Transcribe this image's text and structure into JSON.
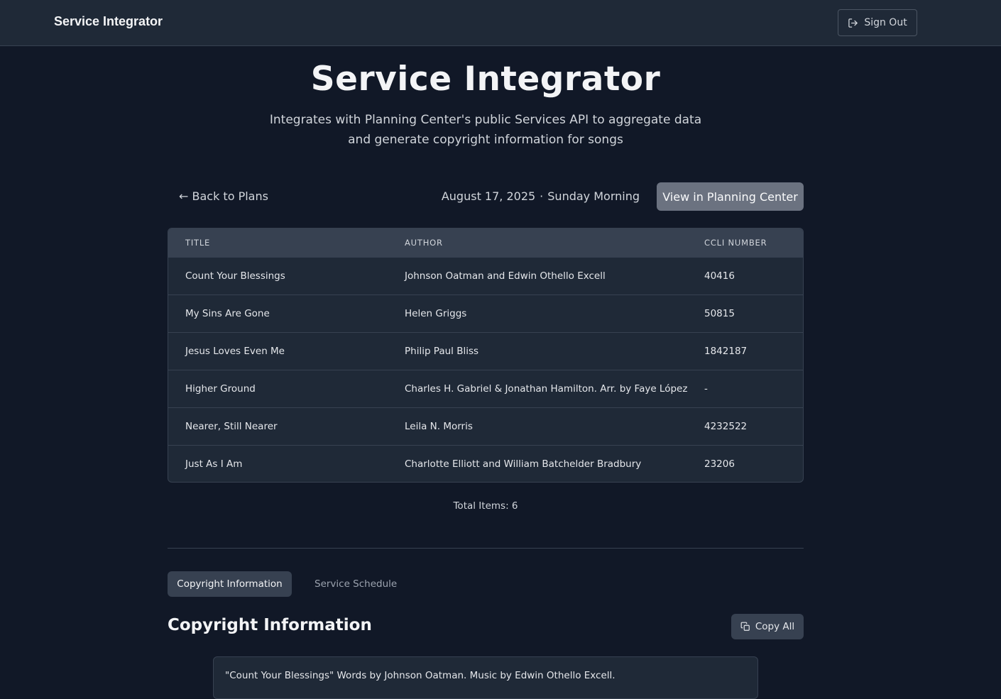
{
  "header": {
    "brand": "Service Integrator",
    "sign_out_label": "Sign Out",
    "sign_out_icon": "sign-out-icon"
  },
  "hero": {
    "title": "Service Integrator",
    "subtitle": "Integrates with Planning Center's public Services API to aggregate data and generate copyright information for songs"
  },
  "plan": {
    "back_label": "← Back to Plans",
    "date": "August 17, 2025",
    "separator": "·",
    "service_type": "Sunday Morning",
    "view_button_label": "View in Planning Center"
  },
  "table": {
    "columns": [
      "TITLE",
      "AUTHOR",
      "CCLI NUMBER"
    ],
    "rows": [
      {
        "title": "Count Your Blessings",
        "author": "Johnson Oatman and Edwin Othello Excell",
        "ccli": "40416"
      },
      {
        "title": "My Sins Are Gone",
        "author": "Helen Griggs",
        "ccli": "50815"
      },
      {
        "title": "Jesus Loves Even Me",
        "author": "Philip Paul Bliss",
        "ccli": "1842187"
      },
      {
        "title": "Higher Ground",
        "author": "Charles H. Gabriel & Jonathan Hamilton. Arr. by Faye López",
        "ccli": "-"
      },
      {
        "title": "Nearer, Still Nearer",
        "author": "Leila N. Morris",
        "ccli": "4232522"
      },
      {
        "title": "Just As I Am",
        "author": "Charlotte Elliott and William Batchelder Bradbury",
        "ccli": "23206"
      }
    ],
    "total_label": "Total Items: 6"
  },
  "tabs": [
    {
      "label": "Copyright Information",
      "active": true
    },
    {
      "label": "Service Schedule",
      "active": false
    }
  ],
  "copyright": {
    "title": "Copyright Information",
    "copy_all_label": "Copy All",
    "copy_icon": "copy-icon",
    "first_entry": "\"Count Your Blessings\" Words by Johnson Oatman. Music by Edwin Othello Excell."
  },
  "colors": {
    "background": "#111827",
    "topbar": "#1f2937",
    "accent_button": "#6b7280"
  }
}
